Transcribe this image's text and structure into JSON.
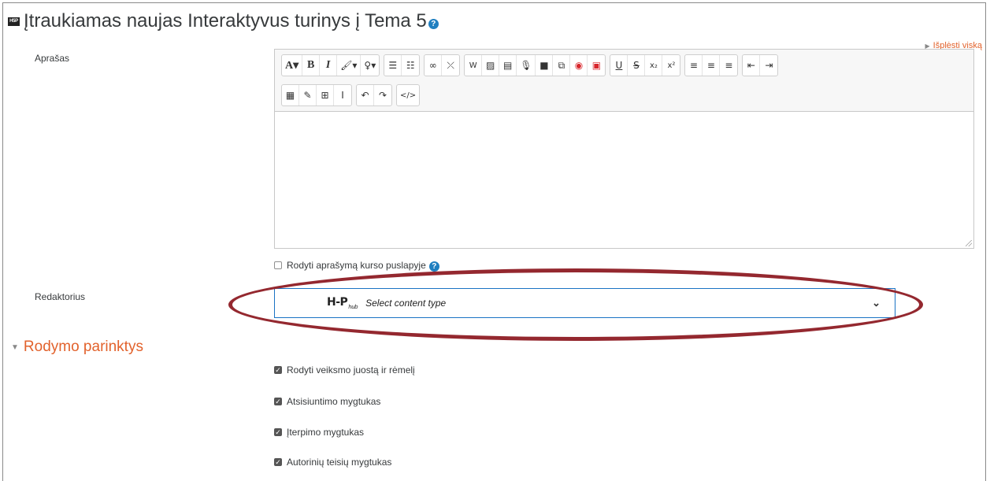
{
  "page": {
    "title": "Įtraukiamas naujas Interaktyvus turinys į Tema 5",
    "title_icon": "h5p-icon",
    "help_icon": "question-circle-icon",
    "expand_all": "Išplėsti viską"
  },
  "description_field": {
    "label": "Aprašas",
    "content": "",
    "show_on_course_page_label": "Rodyti aprašymą kurso puslapyje",
    "show_on_course_page_checked": false
  },
  "toolbar": {
    "row1": [
      [
        "font-size-dropdown-icon",
        "paragraph-style",
        "bold-icon",
        "italic-icon",
        "font-color-icon",
        "highlight-icon"
      ],
      [
        "unordered-list-icon",
        "ordered-list-icon"
      ],
      [
        "link-icon",
        "unlink-icon"
      ],
      [
        "word-import-icon",
        "image-icon",
        "media-icon",
        "record-audio-icon",
        "record-video-icon",
        "manage-files-icon",
        "screencast-icon",
        "pdf-icon"
      ],
      [
        "underline-icon",
        "strikethrough-icon",
        "subscript-icon",
        "superscript-icon"
      ],
      [
        "align-left-icon",
        "align-center-icon",
        "align-right-icon"
      ],
      [
        "outdent-icon",
        "indent-icon"
      ]
    ],
    "row2": [
      [
        "calculator-icon",
        "edit-icon",
        "table-icon",
        "cursor-icon"
      ],
      [
        "undo-icon",
        "redo-icon"
      ],
      [
        "html-code-icon"
      ]
    ]
  },
  "editor_field": {
    "label": "Redaktorius",
    "hub_logo": "H-P",
    "hub_logo_sub": "hub",
    "placeholder": "Select content type"
  },
  "display_options": {
    "section_title": "Rodymo parinktys",
    "options": [
      {
        "label": "Rodyti veiksmo juostą ir rėmelį",
        "checked": true
      },
      {
        "label": "Atsisiuntimo mygtukas",
        "checked": true
      },
      {
        "label": "Įterpimo mygtukas",
        "checked": true
      },
      {
        "label": "Autorinių teisių mygtukas",
        "checked": true
      }
    ]
  },
  "colors": {
    "accent_orange": "#e2622c",
    "highlight_ellipse": "#94282f",
    "select_border": "#1a73c4"
  }
}
